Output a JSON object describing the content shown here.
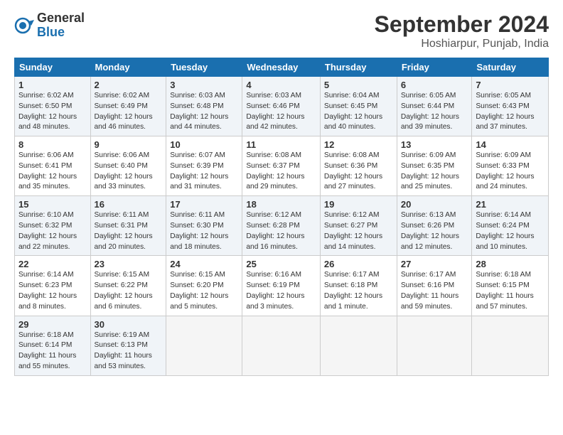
{
  "logo": {
    "general": "General",
    "blue": "Blue"
  },
  "header": {
    "month": "September 2024",
    "location": "Hoshiarpur, Punjab, India"
  },
  "weekdays": [
    "Sunday",
    "Monday",
    "Tuesday",
    "Wednesday",
    "Thursday",
    "Friday",
    "Saturday"
  ],
  "weeks": [
    [
      {
        "day": "1",
        "info": "Sunrise: 6:02 AM\nSunset: 6:50 PM\nDaylight: 12 hours\nand 48 minutes."
      },
      {
        "day": "2",
        "info": "Sunrise: 6:02 AM\nSunset: 6:49 PM\nDaylight: 12 hours\nand 46 minutes."
      },
      {
        "day": "3",
        "info": "Sunrise: 6:03 AM\nSunset: 6:48 PM\nDaylight: 12 hours\nand 44 minutes."
      },
      {
        "day": "4",
        "info": "Sunrise: 6:03 AM\nSunset: 6:46 PM\nDaylight: 12 hours\nand 42 minutes."
      },
      {
        "day": "5",
        "info": "Sunrise: 6:04 AM\nSunset: 6:45 PM\nDaylight: 12 hours\nand 40 minutes."
      },
      {
        "day": "6",
        "info": "Sunrise: 6:05 AM\nSunset: 6:44 PM\nDaylight: 12 hours\nand 39 minutes."
      },
      {
        "day": "7",
        "info": "Sunrise: 6:05 AM\nSunset: 6:43 PM\nDaylight: 12 hours\nand 37 minutes."
      }
    ],
    [
      {
        "day": "8",
        "info": "Sunrise: 6:06 AM\nSunset: 6:41 PM\nDaylight: 12 hours\nand 35 minutes."
      },
      {
        "day": "9",
        "info": "Sunrise: 6:06 AM\nSunset: 6:40 PM\nDaylight: 12 hours\nand 33 minutes."
      },
      {
        "day": "10",
        "info": "Sunrise: 6:07 AM\nSunset: 6:39 PM\nDaylight: 12 hours\nand 31 minutes."
      },
      {
        "day": "11",
        "info": "Sunrise: 6:08 AM\nSunset: 6:37 PM\nDaylight: 12 hours\nand 29 minutes."
      },
      {
        "day": "12",
        "info": "Sunrise: 6:08 AM\nSunset: 6:36 PM\nDaylight: 12 hours\nand 27 minutes."
      },
      {
        "day": "13",
        "info": "Sunrise: 6:09 AM\nSunset: 6:35 PM\nDaylight: 12 hours\nand 25 minutes."
      },
      {
        "day": "14",
        "info": "Sunrise: 6:09 AM\nSunset: 6:33 PM\nDaylight: 12 hours\nand 24 minutes."
      }
    ],
    [
      {
        "day": "15",
        "info": "Sunrise: 6:10 AM\nSunset: 6:32 PM\nDaylight: 12 hours\nand 22 minutes."
      },
      {
        "day": "16",
        "info": "Sunrise: 6:11 AM\nSunset: 6:31 PM\nDaylight: 12 hours\nand 20 minutes."
      },
      {
        "day": "17",
        "info": "Sunrise: 6:11 AM\nSunset: 6:30 PM\nDaylight: 12 hours\nand 18 minutes."
      },
      {
        "day": "18",
        "info": "Sunrise: 6:12 AM\nSunset: 6:28 PM\nDaylight: 12 hours\nand 16 minutes."
      },
      {
        "day": "19",
        "info": "Sunrise: 6:12 AM\nSunset: 6:27 PM\nDaylight: 12 hours\nand 14 minutes."
      },
      {
        "day": "20",
        "info": "Sunrise: 6:13 AM\nSunset: 6:26 PM\nDaylight: 12 hours\nand 12 minutes."
      },
      {
        "day": "21",
        "info": "Sunrise: 6:14 AM\nSunset: 6:24 PM\nDaylight: 12 hours\nand 10 minutes."
      }
    ],
    [
      {
        "day": "22",
        "info": "Sunrise: 6:14 AM\nSunset: 6:23 PM\nDaylight: 12 hours\nand 8 minutes."
      },
      {
        "day": "23",
        "info": "Sunrise: 6:15 AM\nSunset: 6:22 PM\nDaylight: 12 hours\nand 6 minutes."
      },
      {
        "day": "24",
        "info": "Sunrise: 6:15 AM\nSunset: 6:20 PM\nDaylight: 12 hours\nand 5 minutes."
      },
      {
        "day": "25",
        "info": "Sunrise: 6:16 AM\nSunset: 6:19 PM\nDaylight: 12 hours\nand 3 minutes."
      },
      {
        "day": "26",
        "info": "Sunrise: 6:17 AM\nSunset: 6:18 PM\nDaylight: 12 hours\nand 1 minute."
      },
      {
        "day": "27",
        "info": "Sunrise: 6:17 AM\nSunset: 6:16 PM\nDaylight: 11 hours\nand 59 minutes."
      },
      {
        "day": "28",
        "info": "Sunrise: 6:18 AM\nSunset: 6:15 PM\nDaylight: 11 hours\nand 57 minutes."
      }
    ],
    [
      {
        "day": "29",
        "info": "Sunrise: 6:18 AM\nSunset: 6:14 PM\nDaylight: 11 hours\nand 55 minutes."
      },
      {
        "day": "30",
        "info": "Sunrise: 6:19 AM\nSunset: 6:13 PM\nDaylight: 11 hours\nand 53 minutes."
      },
      {
        "day": "",
        "info": ""
      },
      {
        "day": "",
        "info": ""
      },
      {
        "day": "",
        "info": ""
      },
      {
        "day": "",
        "info": ""
      },
      {
        "day": "",
        "info": ""
      }
    ]
  ]
}
